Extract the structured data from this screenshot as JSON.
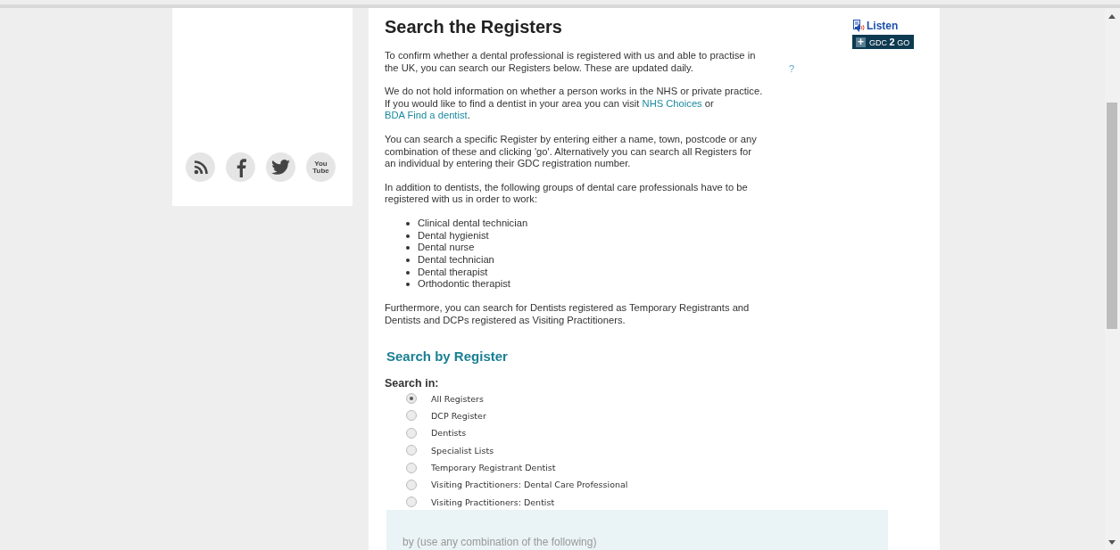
{
  "social_links": [
    {
      "kind": "rss"
    },
    {
      "kind": "facebook"
    },
    {
      "kind": "twitter"
    },
    {
      "kind": "youtube",
      "label": "You Tube"
    }
  ],
  "title": "Search the Registers",
  "paragraphs": [
    [
      {
        "text": "To confirm whether a dental professional is registered with us and able to practise in the UK,  you can search our Registers below. These are updated daily."
      }
    ],
    [
      {
        "text": "We do not hold information on whether a person works in the NHS or private practice. If you would like to find a dentist in your area you can visit "
      },
      {
        "link": "NHS Choices"
      },
      {
        "text": " or "
      },
      {
        "link": "BDA Find a dentist"
      },
      {
        "text": "."
      }
    ],
    [
      {
        "text": "You can search a specific Register by entering either a name, town, postcode or any combination of these and clicking 'go'. Alternatively you can search all Registers for an individual by entering their GDC registration number."
      }
    ],
    [
      {
        "text": "In addition to dentists, the following groups of dental care professionals have to be registered with us in order to work:"
      }
    ]
  ],
  "groups": [
    "Clinical dental technician",
    "Dental hygienist",
    "Dental nurse",
    "Dental technician",
    "Dental therapist",
    "Orthodontic therapist"
  ],
  "closing_paragraph": "Furthermore, you can search for Dentists registered as Temporary Registrants and Dentists and DCPs registered as Visiting Practitioners.",
  "help_link": "?",
  "listen_link": "Listen",
  "app_button": {
    "plus": "+",
    "label": "GDC",
    "number": "2",
    "suffix": "GO"
  },
  "search_section": {
    "heading": "Search by Register",
    "search_in_label": "Search in:",
    "options": [
      {
        "label": "All Registers",
        "selected": true
      },
      {
        "label": "DCP Register",
        "selected": false
      },
      {
        "label": "Dentists",
        "selected": false
      },
      {
        "label": "Specialist Lists",
        "selected": false
      },
      {
        "label": "Temporary Registrant Dentist",
        "selected": false
      },
      {
        "label": "Visiting Practitioners: Dental Care Professional",
        "selected": false
      },
      {
        "label": "Visiting Practitioners: Dentist",
        "selected": false
      }
    ],
    "criteria_label": "by (use any combination of the following)"
  }
}
